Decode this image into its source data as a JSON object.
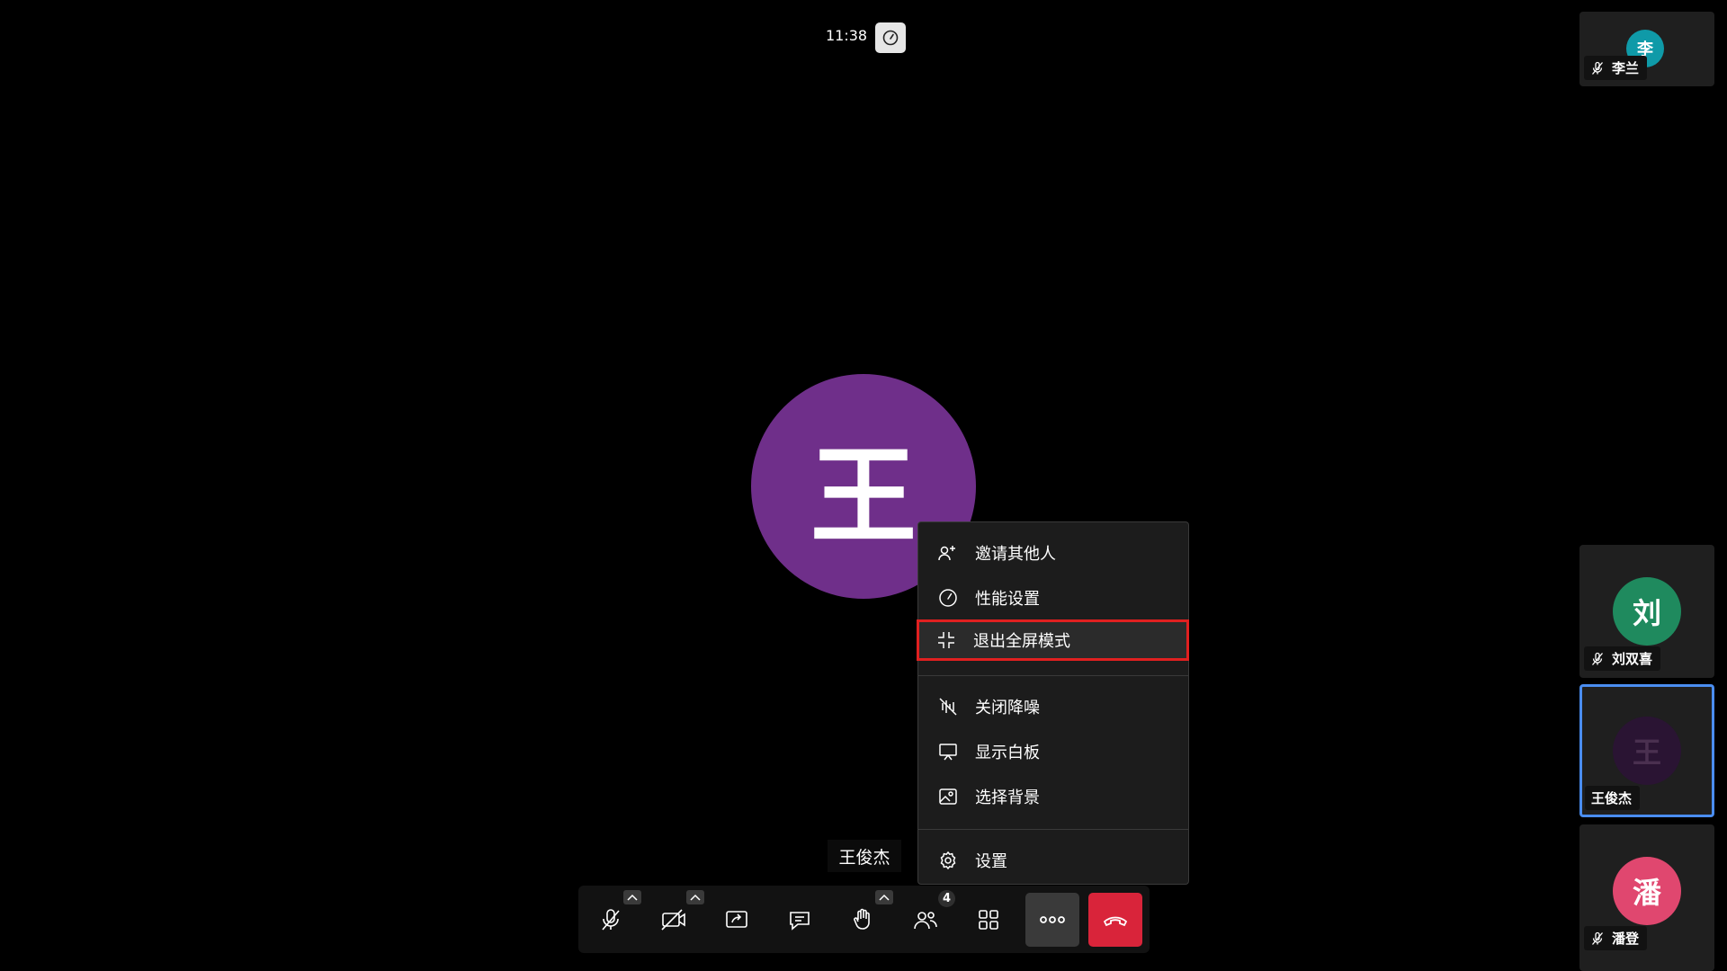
{
  "top": {
    "time": "11:38"
  },
  "main": {
    "avatar_char": "王",
    "avatar_color": "#6f2f8a",
    "name": "王俊杰"
  },
  "menu": {
    "items": [
      {
        "label": "邀请其他人",
        "icon": "add-person-icon"
      },
      {
        "label": "性能设置",
        "icon": "gauge-icon"
      },
      {
        "label": "退出全屏模式",
        "icon": "exit-fullscreen-icon",
        "highlighted": true
      },
      {
        "label": "关闭降噪",
        "icon": "noise-cancel-off-icon"
      },
      {
        "label": "显示白板",
        "icon": "whiteboard-icon"
      },
      {
        "label": "选择背景",
        "icon": "background-image-icon"
      },
      {
        "label": "设置",
        "icon": "gear-icon"
      }
    ]
  },
  "toolbar": {
    "participants_count": "4",
    "hangup_color": "#d9243a",
    "icons": [
      "mic-muted-icon",
      "camera-off-icon",
      "share-screen-icon",
      "chat-icon",
      "raise-hand-icon",
      "participants-icon",
      "layout-grid-icon",
      "more-icon",
      "hangup-icon"
    ]
  },
  "participants": [
    {
      "name": "李兰",
      "char": "李",
      "color": "#0f9aa8",
      "muted": true
    },
    {
      "name": "刘双喜",
      "char": "刘",
      "color": "#1f8a5e",
      "muted": true
    },
    {
      "name": "王俊杰",
      "char": "王",
      "color": "#2a1433",
      "muted": false,
      "active": true
    },
    {
      "name": "潘登",
      "char": "潘",
      "color": "#e0476f",
      "muted": true
    }
  ]
}
